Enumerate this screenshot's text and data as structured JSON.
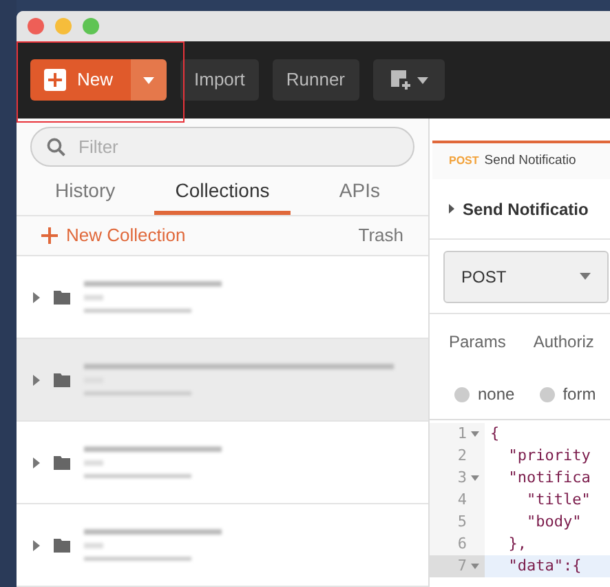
{
  "toolbar": {
    "new_button": "New",
    "buttons": [
      "Import",
      "Runner"
    ]
  },
  "sidebar": {
    "filter": {
      "placeholder": "Filter"
    },
    "tabs": [
      {
        "label": "History",
        "selected": false
      },
      {
        "label": "Collections",
        "selected": true
      },
      {
        "label": "APIs",
        "selected": false
      }
    ],
    "new_collection": "New Collection",
    "trash": "Trash",
    "collections": [
      {
        "selected": false
      },
      {
        "selected": true
      },
      {
        "selected": false
      },
      {
        "selected": false
      }
    ]
  },
  "request": {
    "tab": {
      "method": "POST",
      "name": "Send Notificatio"
    },
    "title": "Send Notificatio",
    "method": "POST",
    "tabs": [
      {
        "label": "Params"
      },
      {
        "label": "Authoriz"
      }
    ],
    "body_types": [
      {
        "label": "none",
        "selected": false
      },
      {
        "label": "form",
        "selected": false
      }
    ],
    "code": [
      {
        "number": "1",
        "text": "{",
        "foldable": true,
        "active": false
      },
      {
        "number": "2",
        "text": "  \"priority",
        "foldable": false,
        "active": false
      },
      {
        "number": "3",
        "text": "  \"notifica",
        "foldable": true,
        "active": false
      },
      {
        "number": "4",
        "text": "    \"title\"",
        "foldable": false,
        "active": false
      },
      {
        "number": "5",
        "text": "    \"body\"",
        "foldable": false,
        "active": false
      },
      {
        "number": "6",
        "text": "  },",
        "foldable": false,
        "active": false
      },
      {
        "number": "7",
        "text": "  \"data\":{",
        "foldable": true,
        "active": true
      }
    ]
  }
}
